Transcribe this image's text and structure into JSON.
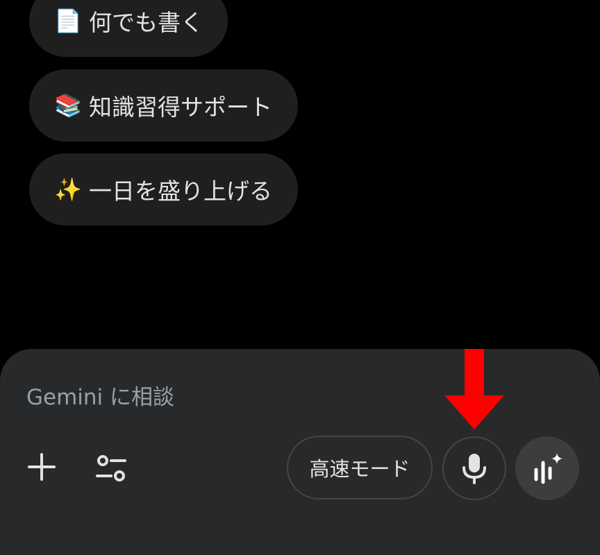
{
  "suggestions": [
    {
      "emoji": "📄",
      "icon": "document-icon",
      "label": "何でも書く"
    },
    {
      "emoji": "📚",
      "icon": "books-icon",
      "label": "知識習得サポート"
    },
    {
      "emoji": "✨",
      "icon": "sparkles-icon",
      "label": "一日を盛り上げる"
    }
  ],
  "composer": {
    "placeholder": "Gemini に相談",
    "add_icon": "plus-icon",
    "tools_icon": "tools-icon",
    "mode_label": "高速モード",
    "mic_icon": "microphone-icon",
    "live_icon": "gemini-live-icon"
  },
  "annotation": {
    "icon": "red-arrow-icon",
    "color": "#ff0000"
  },
  "colors": {
    "background": "#000000",
    "chip": "#1f1f1f",
    "composer": "#28292a",
    "text": "#e3e3e3",
    "placeholder": "#9aa0a6"
  }
}
